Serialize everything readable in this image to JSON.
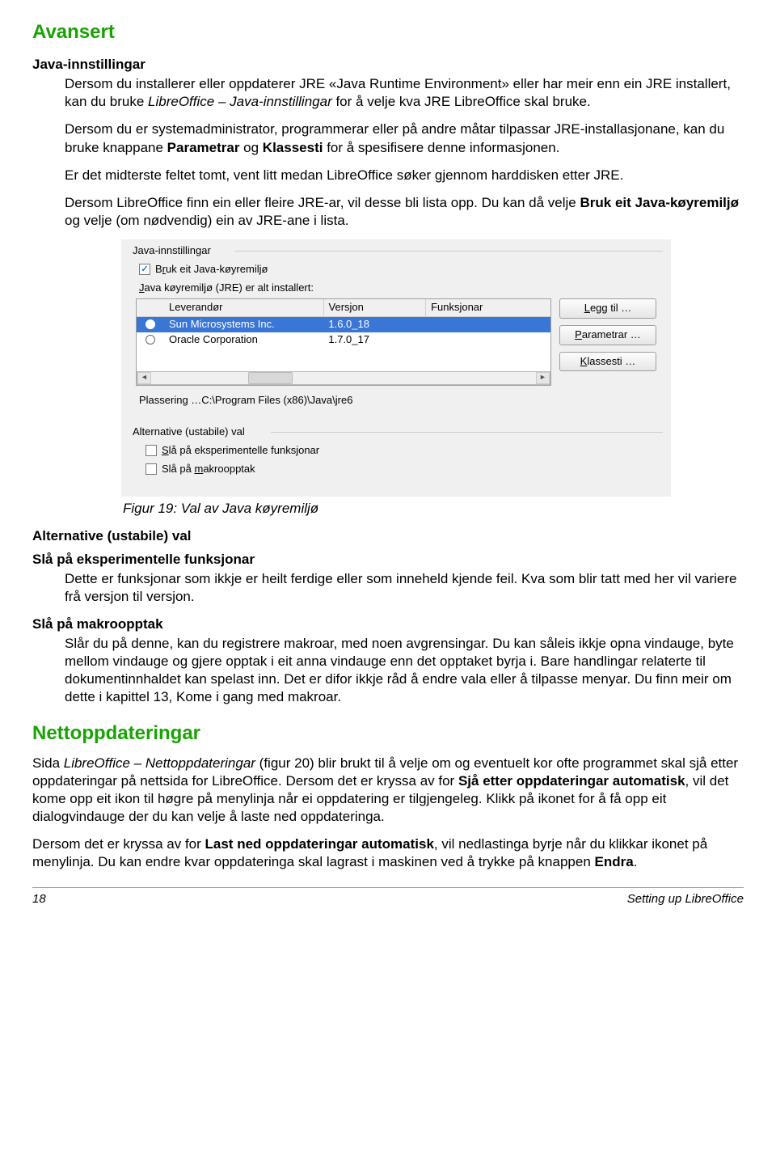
{
  "h_avansert": "Avansert",
  "h_java": "Java-innstillingar",
  "p1_a": "Dersom du installerer eller oppdaterer JRE «Java Runtime Environment» eller har meir enn ein JRE installert, kan du bruke ",
  "p1_b": "LibreOffice – Java-innstillingar",
  "p1_c": " for å velje kva JRE LibreOffice skal bruke.",
  "p2_a": "Dersom du er systemadministrator, programmerar eller på andre måtar tilpassar JRE-installasjonane, kan du bruke knappane ",
  "p2_b": "Parametrar",
  "p2_c": " og ",
  "p2_d": "Klassesti",
  "p2_e": " for å spesifisere denne informasjonen.",
  "p3": "Er det midterste feltet tomt, vent litt medan LibreOffice søker gjennom harddisken etter JRE.",
  "p4_a": "Dersom LibreOffice finn ein eller fleire JRE-ar, vil desse bli lista opp. Du kan då velje ",
  "p4_b": "Bruk eit Java-køyremiljø",
  "p4_c": " og velje (om nødvendig) ein av JRE-ane i lista.",
  "dialog": {
    "group1": "Java-innstillingar",
    "chk_bruk_pre": "B",
    "chk_bruk_u": "r",
    "chk_bruk_post": "uk eit Java-køyremiljø",
    "jre_label_pre": "",
    "jre_label_u": "J",
    "jre_label_post": "ava køyremiljø (JRE) er alt installert:",
    "hdr_vendor": "Leverandør",
    "hdr_version": "Versjon",
    "hdr_features": "Funksjonar",
    "rows": [
      {
        "vendor": "Sun Microsystems Inc.",
        "version": "1.6.0_18"
      },
      {
        "vendor": "Oracle Corporation",
        "version": "1.7.0_17"
      }
    ],
    "btn_add_pre": "",
    "btn_add_u": "L",
    "btn_add_post": "egg til …",
    "btn_param_pre": "",
    "btn_param_u": "P",
    "btn_param_post": "arametrar …",
    "btn_class_pre": "",
    "btn_class_u": "K",
    "btn_class_post": "lassesti …",
    "location": "Plassering …C:\\Program Files (x86)\\Java\\jre6",
    "group2": "Alternative (ustabile) val",
    "chk_exp_pre": "",
    "chk_exp_u": "S",
    "chk_exp_post": "lå på eksperimentelle funksjonar",
    "chk_macro_pre": "Slå på ",
    "chk_macro_u": "m",
    "chk_macro_post": "akroopptak"
  },
  "fig_caption": "Figur 19: Val av Java køyremiljø",
  "h_alt": "Alternative (ustabile) val",
  "h_exp": "Slå på eksperimentelle funksjonar",
  "p_exp": "Dette er funksjonar som ikkje er heilt ferdige eller som inneheld kjende feil. Kva som blir tatt med her vil variere frå versjon til versjon.",
  "h_macro": "Slå på makroopptak",
  "p_macro": "Slår du på denne, kan du registrere makroar, med noen avgrensingar. Du kan såleis ikkje opna vindauge, byte mellom vindauge og gjere opptak i eit anna vindauge enn det opptaket byrja i. Bare handlingar relaterte til dokumentinnhaldet kan spelast inn. Det er difor ikkje råd å endre vala eller å tilpasse menyar. Du finn meir om dette i kapittel 13, Kome i gang med makroar.",
  "h_net": "Nettoppdateringar",
  "p_net1_a": "Sida ",
  "p_net1_b": "LibreOffice – Nettoppdateringar",
  "p_net1_c": " (figur 20) blir brukt til å velje om og eventuelt kor ofte programmet skal sjå etter oppdateringar på nettsida for LibreOffice. Dersom det er kryssa av for ",
  "p_net1_d": "Sjå etter oppdateringar automatisk",
  "p_net1_e": ", vil det kome opp eit ikon til høgre på menylinja når ei oppdatering er tilgjengeleg. Klikk på ikonet for å få opp eit dialogvindauge der du kan velje å laste ned oppdateringa.",
  "p_net2_a": "Dersom det er kryssa av for ",
  "p_net2_b": "Last ned oppdateringar automatisk",
  "p_net2_c": ", vil nedlastinga byrje når du klikkar ikonet på menylinja. Du kan endre kvar oppdateringa skal lagrast i maskinen ved å trykke på knappen ",
  "p_net2_d": "Endra",
  "p_net2_e": ".",
  "footer_page": "18",
  "footer_title": "Setting up LibreOffice"
}
